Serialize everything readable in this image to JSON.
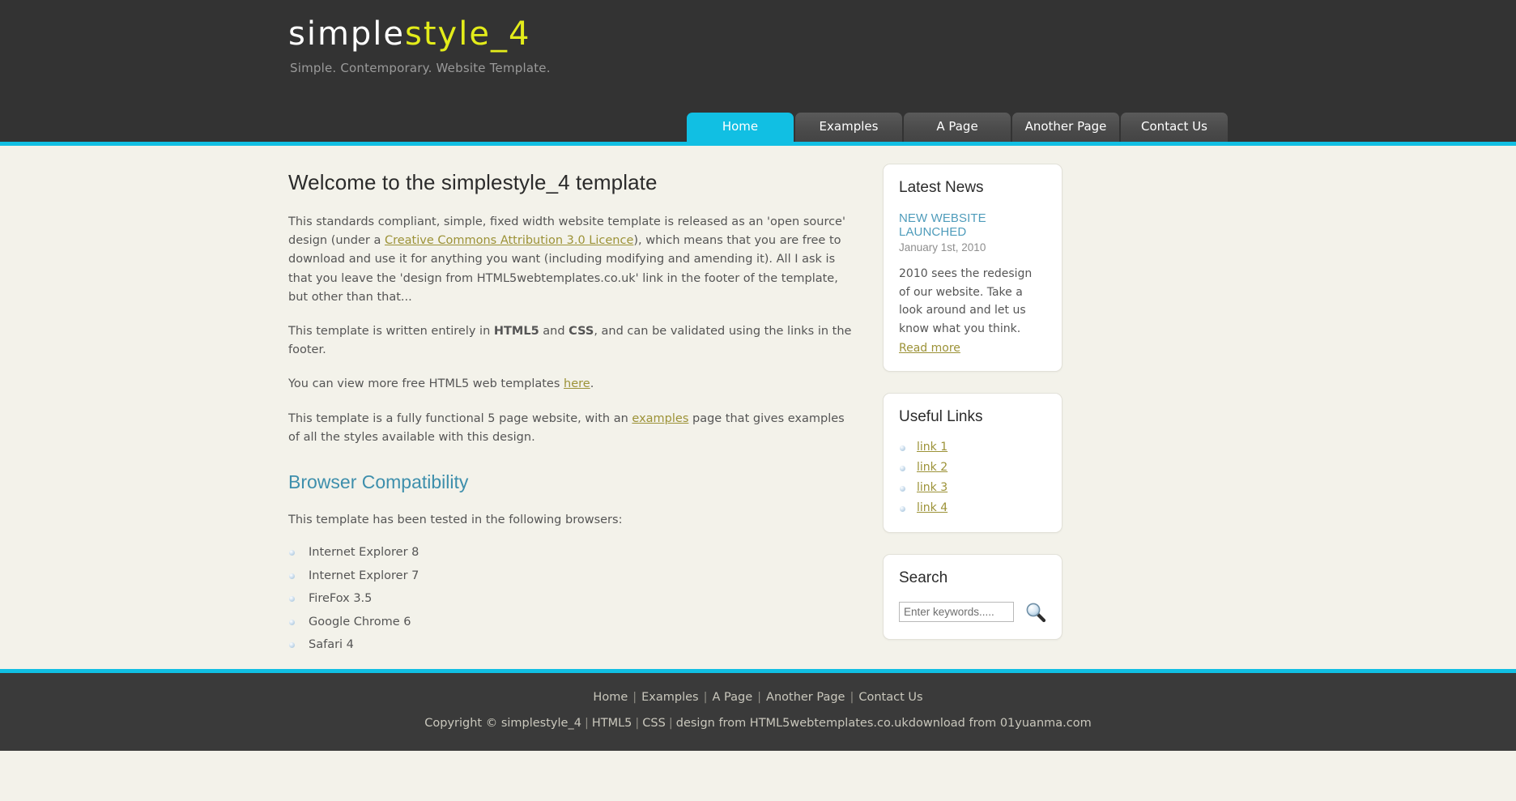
{
  "site": {
    "logo_part_a": "simple",
    "logo_part_b": "style_4",
    "tagline": "Simple. Contemporary. Website Template."
  },
  "colors": {
    "accent_cyan": "#11bfe3",
    "logo_yellow": "#e3ec1a",
    "header_dark": "#333333",
    "page_bg": "#f3f2ea",
    "link_olive": "#9c9237",
    "heading_teal": "#3e8fac"
  },
  "nav": {
    "items": [
      {
        "label": "Home",
        "active": true
      },
      {
        "label": "Examples",
        "active": false
      },
      {
        "label": "A Page",
        "active": false
      },
      {
        "label": "Another Page",
        "active": false
      },
      {
        "label": "Contact Us",
        "active": false
      }
    ]
  },
  "main": {
    "title": "Welcome to the simplestyle_4 template",
    "p1_before_link": "This standards compliant, simple, fixed width website template is released as an 'open source' design (under a ",
    "p1_link": "Creative Commons Attribution 3.0 Licence",
    "p1_after_link": "), which means that you are free to download and use it for anything you want (including modifying and amending it). All I ask is that you leave the 'design from HTML5webtemplates.co.uk' link in the footer of the template, but other than that...",
    "p2_a": "This template is written entirely in ",
    "p2_b": "HTML5",
    "p2_c": " and ",
    "p2_d": "CSS",
    "p2_e": ", and can be validated using the links in the footer.",
    "p3_before_link": "You can view more free HTML5 web templates ",
    "p3_link": "here",
    "p3_after_link": ".",
    "p4_before_link": "This template is a fully functional 5 page website, with an ",
    "p4_link": "examples",
    "p4_after_link": " page that gives examples of all the styles available with this design.",
    "section_title": "Browser Compatibility",
    "section_intro": "This template has been tested in the following browsers:",
    "browsers": [
      "Internet Explorer 8",
      "Internet Explorer 7",
      "FireFox 3.5",
      "Google Chrome 6",
      "Safari 4"
    ]
  },
  "sidebar": {
    "news": {
      "heading": "Latest News",
      "item_title": "NEW WEBSITE LAUNCHED",
      "item_date": "January 1st, 2010",
      "item_body": "2010 sees the redesign of our website. Take a look around and let us know what you think.",
      "read_more": "Read more"
    },
    "links": {
      "heading": "Useful Links",
      "items": [
        "link 1",
        "link 2",
        "link 3",
        "link 4"
      ]
    },
    "search": {
      "heading": "Search",
      "placeholder": "Enter keywords.....",
      "value": "",
      "icon": "magnifier-icon"
    }
  },
  "footer": {
    "nav": [
      "Home",
      "Examples",
      "A Page",
      "Another Page",
      "Contact Us"
    ],
    "copyright_a": "Copyright © simplestyle_4",
    "link_html5": "HTML5",
    "link_css": "CSS",
    "credit": "design from HTML5webtemplates.co.ukdownload from 01yuanma.com"
  }
}
